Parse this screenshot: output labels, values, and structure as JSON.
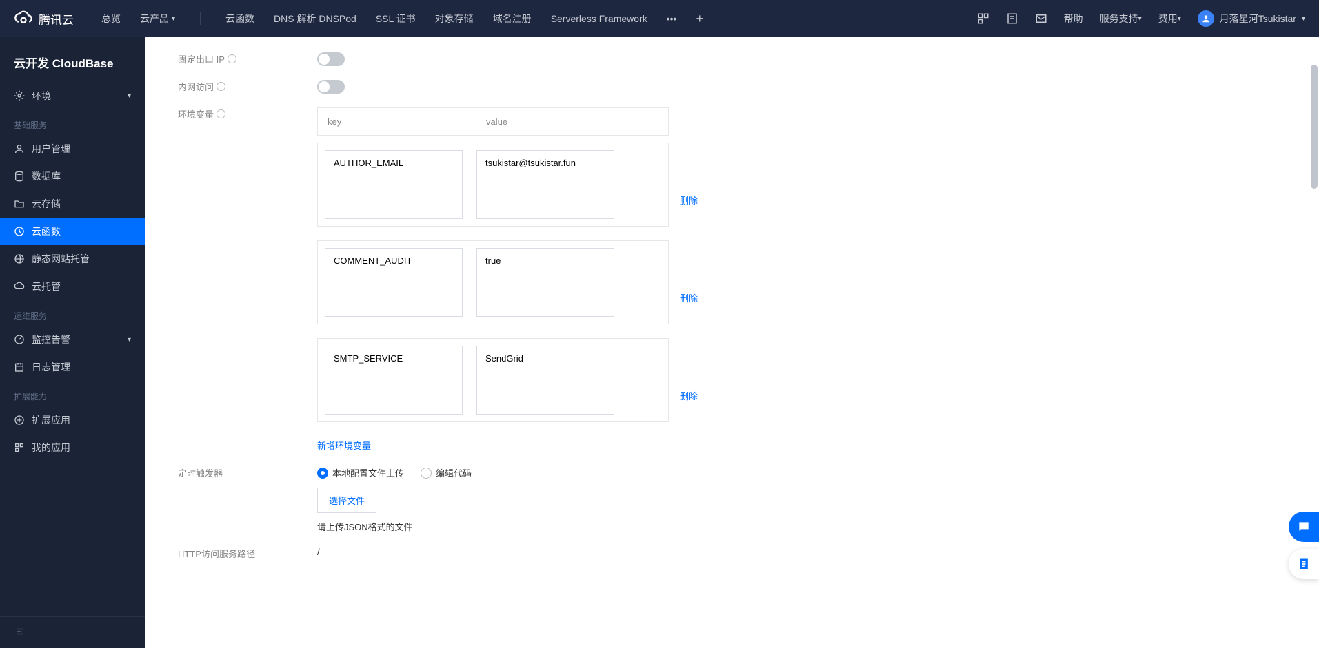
{
  "topbar": {
    "brand": "腾讯云",
    "nav": {
      "overview": "总览",
      "products": "云产品",
      "items": [
        "云函数",
        "DNS 解析 DNSPod",
        "SSL 证书",
        "对象存储",
        "域名注册",
        "Serverless Framework"
      ]
    },
    "right": {
      "help": "帮助",
      "support": "服务支持",
      "billing": "费用",
      "user": "月落星河Tsukistar"
    }
  },
  "sidebar": {
    "title": "云开发 CloudBase",
    "env_item": "环境",
    "sections": {
      "basic": {
        "label": "基础服务",
        "items": [
          "用户管理",
          "数据库",
          "云存储",
          "云函数",
          "静态网站托管",
          "云托管"
        ]
      },
      "ops": {
        "label": "运维服务",
        "items": [
          "监控告警",
          "日志管理"
        ]
      },
      "ext": {
        "label": "扩展能力",
        "items": [
          "扩展应用",
          "我的应用"
        ]
      }
    },
    "active": "云函数"
  },
  "form": {
    "fixed_ip": {
      "label": "固定出口 IP",
      "on": false
    },
    "intranet": {
      "label": "内网访问",
      "on": false
    },
    "env_vars": {
      "label": "环境变量",
      "head_key": "key",
      "head_value": "value",
      "rows": [
        {
          "key": "AUTHOR_EMAIL",
          "value": "tsukistar@tsukistar.fun"
        },
        {
          "key": "COMMENT_AUDIT",
          "value": "true"
        },
        {
          "key": "SMTP_SERVICE",
          "value": "SendGrid"
        }
      ],
      "delete": "删除",
      "add": "新增环境变量"
    },
    "trigger": {
      "label": "定时触发器",
      "opt_upload": "本地配置文件上传",
      "opt_edit": "编辑代码",
      "select_file": "选择文件",
      "hint": "请上传JSON格式的文件"
    },
    "http_path": {
      "label": "HTTP访问服务路径",
      "value": "/"
    }
  }
}
